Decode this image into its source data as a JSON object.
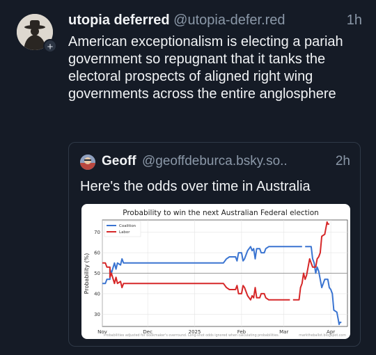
{
  "post": {
    "display_name": "utopia deferred",
    "handle": "@utopia-defer.red",
    "time": "1h",
    "follow_symbol": "+",
    "text": "American exceptionalism is electing a pariah government so repugnant that it tanks the electoral prospects of aligned right wing governments across the entire anglosphere"
  },
  "quote": {
    "display_name": "Geoff",
    "handle": "@geoffdeburca.bsky.so..",
    "time": "2h",
    "text": "Here's the odds over time in Australia"
  },
  "chart_data": {
    "type": "line",
    "title": "Probability to win the next Australian Federal election",
    "ylabel": "Probability (%)",
    "xlabel": "",
    "ylim": [
      24,
      76
    ],
    "yticks": [
      30,
      40,
      50,
      60,
      70
    ],
    "xticks": [
      {
        "label": "Nov",
        "t": 0
      },
      {
        "label": "Dec",
        "t": 30
      },
      {
        "label": "2025",
        "t": 61
      },
      {
        "label": "Feb",
        "t": 92
      },
      {
        "label": "Mar",
        "t": 120
      },
      {
        "label": "Apr",
        "t": 151
      }
    ],
    "xlim": [
      0,
      162
    ],
    "reference_line": 50,
    "legend_position": "top-left",
    "footer_left": "Probabilities adjusted for bookmaker's overround. Long-shot odds ignored when calculating probabilities.",
    "footer_right": "marktheballot.blogspot.com",
    "series": [
      {
        "name": "Coalition",
        "color": "#3a74d1",
        "points": [
          [
            0,
            45
          ],
          [
            2,
            45
          ],
          [
            3,
            47
          ],
          [
            5,
            47
          ],
          [
            5,
            52
          ],
          [
            6,
            50
          ],
          [
            8,
            55
          ],
          [
            9,
            52
          ],
          [
            10,
            55
          ],
          [
            12,
            54
          ],
          [
            13,
            57
          ],
          [
            14,
            55
          ],
          [
            16,
            55
          ],
          [
            48,
            55
          ],
          [
            80,
            55
          ],
          [
            82,
            57
          ],
          [
            84,
            58
          ],
          [
            88,
            58
          ],
          [
            89,
            56
          ],
          [
            90,
            60
          ],
          [
            92,
            60
          ],
          [
            93,
            56
          ],
          [
            94,
            57
          ],
          [
            96,
            61
          ],
          [
            98,
            63
          ],
          [
            99,
            61
          ],
          [
            100,
            62
          ],
          [
            101,
            57
          ],
          [
            102,
            62
          ],
          [
            104,
            62
          ],
          [
            105,
            60
          ],
          [
            107,
            60
          ],
          [
            108,
            62
          ],
          [
            110,
            63
          ],
          [
            116,
            63
          ],
          [
            132,
            63
          ],
          [
            null,
            null
          ],
          [
            134,
            63
          ],
          [
            138,
            63
          ],
          [
            139,
            57
          ],
          [
            140,
            55
          ],
          [
            141,
            50
          ],
          [
            142,
            53
          ],
          [
            143,
            51
          ],
          [
            145,
            43
          ],
          [
            147,
            47
          ],
          [
            149,
            47
          ],
          [
            150,
            43
          ],
          [
            151,
            42
          ],
          [
            152,
            40
          ],
          [
            153,
            32
          ],
          [
            155,
            31
          ],
          [
            156,
            27
          ],
          [
            156.5,
            25
          ],
          [
            157,
            26
          ],
          [
            158,
            26
          ]
        ]
      },
      {
        "name": "Labor",
        "color": "#d62728",
        "points": [
          [
            0,
            55
          ],
          [
            2,
            55
          ],
          [
            3,
            53
          ],
          [
            5,
            53
          ],
          [
            5,
            48
          ],
          [
            6,
            50
          ],
          [
            8,
            45
          ],
          [
            9,
            48
          ],
          [
            10,
            45
          ],
          [
            12,
            46
          ],
          [
            13,
            43
          ],
          [
            14,
            45
          ],
          [
            16,
            45
          ],
          [
            48,
            45
          ],
          [
            80,
            45
          ],
          [
            82,
            43
          ],
          [
            84,
            42
          ],
          [
            88,
            42
          ],
          [
            89,
            44
          ],
          [
            90,
            40
          ],
          [
            92,
            40
          ],
          [
            93,
            44
          ],
          [
            94,
            43
          ],
          [
            96,
            39
          ],
          [
            98,
            37
          ],
          [
            99,
            39
          ],
          [
            100,
            38
          ],
          [
            101,
            43
          ],
          [
            102,
            38
          ],
          [
            104,
            38
          ],
          [
            105,
            40
          ],
          [
            107,
            40
          ],
          [
            108,
            38
          ],
          [
            110,
            37
          ],
          [
            116,
            37
          ],
          [
            124,
            37
          ],
          [
            null,
            null
          ],
          [
            126,
            37
          ],
          [
            130,
            37
          ],
          [
            131,
            43
          ],
          [
            132,
            45
          ],
          [
            133,
            50
          ],
          [
            134,
            47
          ],
          [
            135,
            49
          ],
          [
            137,
            57
          ],
          [
            139,
            53
          ],
          [
            141,
            53
          ],
          [
            142,
            57
          ],
          [
            143,
            58
          ],
          [
            144,
            60
          ],
          [
            145,
            68
          ],
          [
            147,
            69
          ],
          [
            148,
            73
          ],
          [
            148.5,
            75
          ],
          [
            149,
            74
          ],
          [
            150,
            74
          ]
        ]
      }
    ]
  }
}
